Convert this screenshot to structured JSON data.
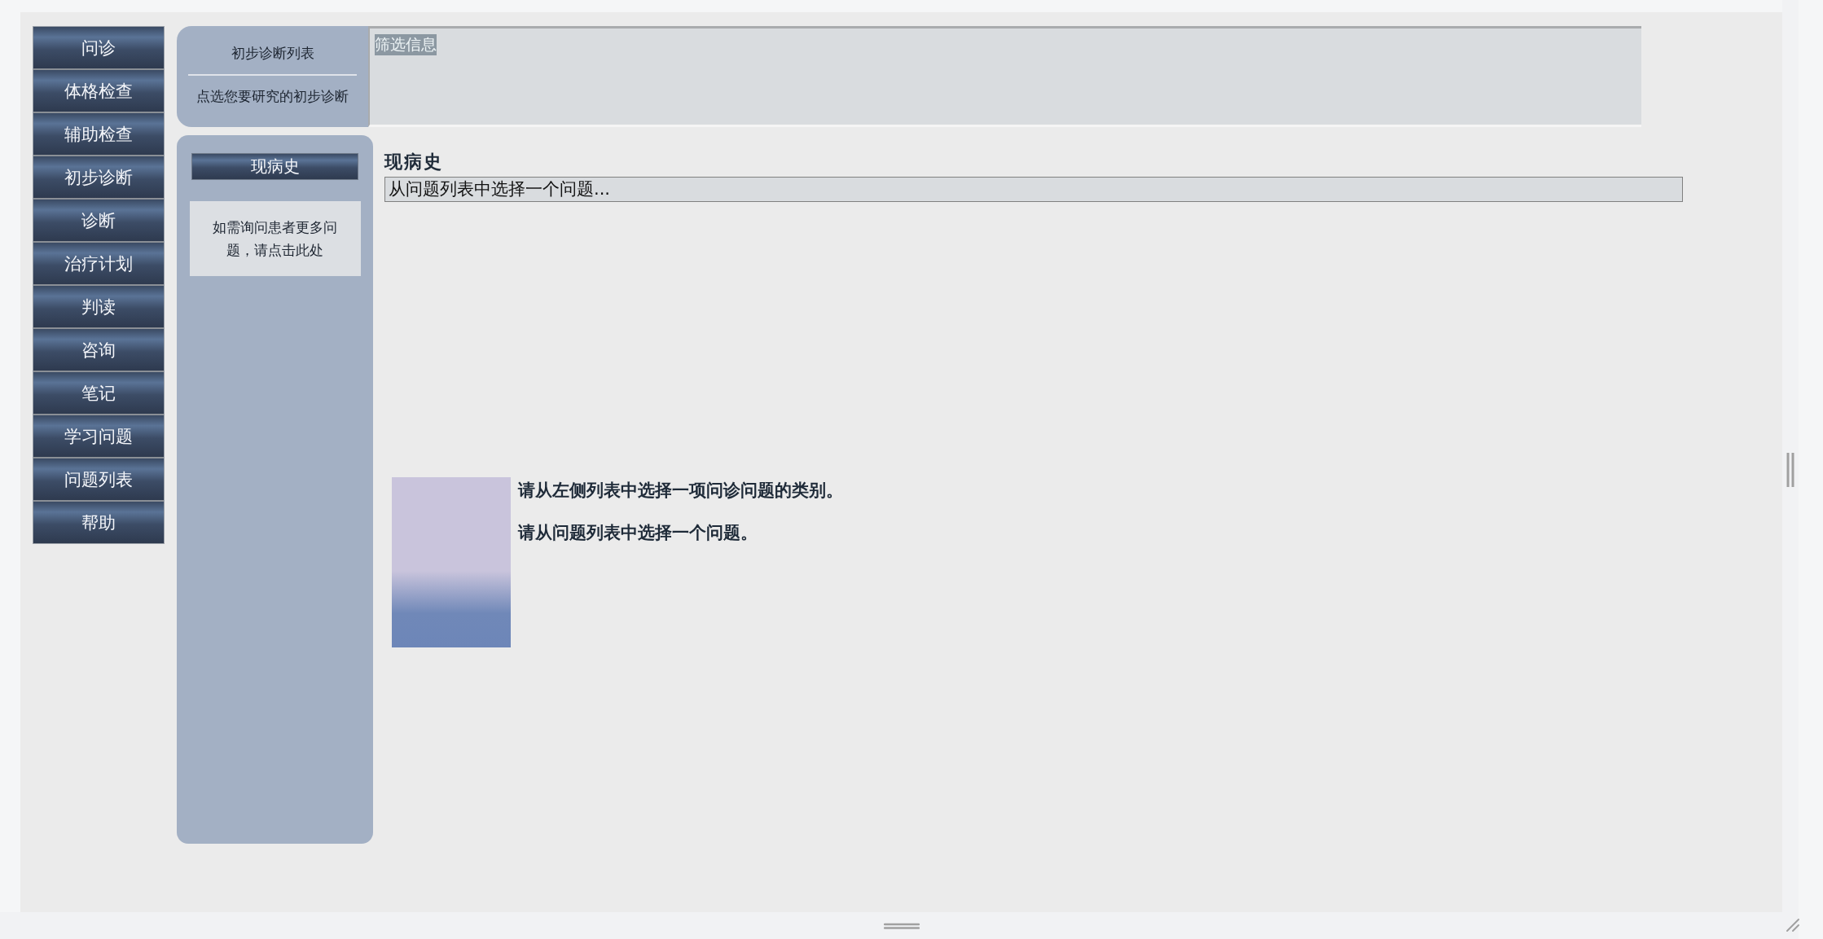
{
  "nav": {
    "items": [
      {
        "label": "问诊"
      },
      {
        "label": "体格检查"
      },
      {
        "label": "辅助检查"
      },
      {
        "label": "初步诊断"
      },
      {
        "label": "诊断"
      },
      {
        "label": "治疗计划"
      },
      {
        "label": "判读"
      },
      {
        "label": "咨询"
      },
      {
        "label": "笔记"
      },
      {
        "label": "学习问题"
      },
      {
        "label": "问题列表"
      },
      {
        "label": "帮助"
      }
    ]
  },
  "diagnosis_panel": {
    "title": "初步诊断列表",
    "hint": "点选您要研究的初步诊断"
  },
  "filter_panel": {
    "label": "筛选信息"
  },
  "category_panel": {
    "category": "现病史",
    "more_questions": "如需询问患者更多问题，请点击此处"
  },
  "main": {
    "heading": "现病史",
    "question_select": {
      "value": "从问题列表中选择一个问题..."
    },
    "instructions": [
      "请从左侧列表中选择一项问诊问题的类别。",
      "请从问题列表中选择一个问题。"
    ]
  }
}
